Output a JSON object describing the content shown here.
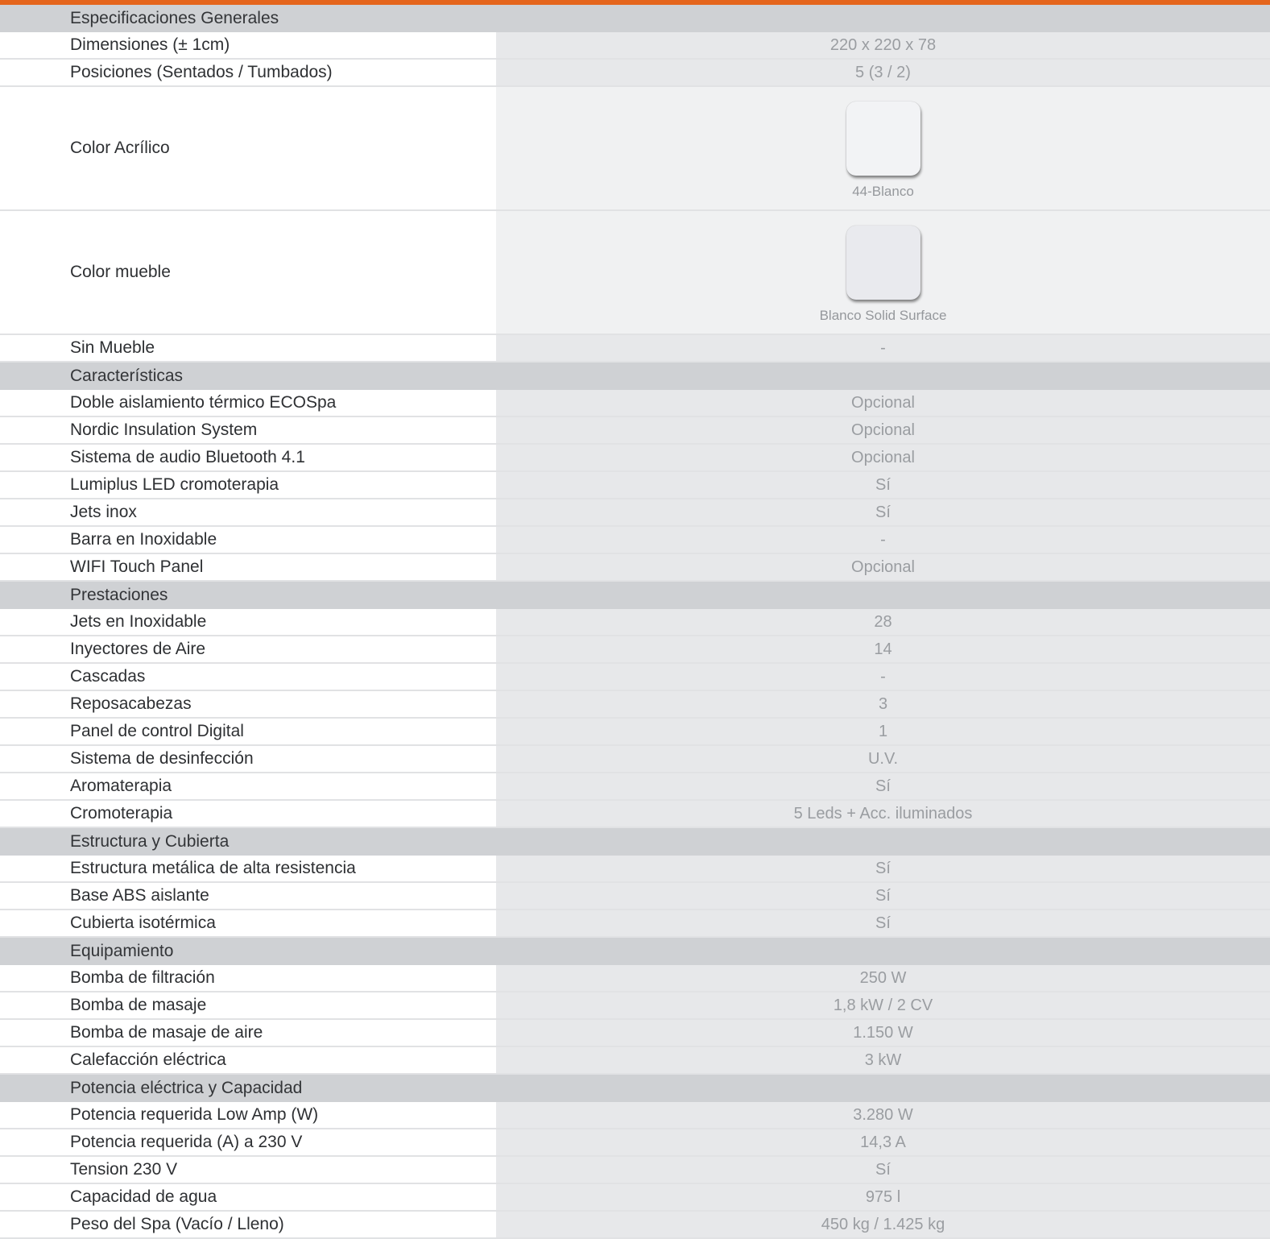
{
  "colors": {
    "accent": "#e5651c",
    "section_bg": "#cfd1d4",
    "value_bg": "#e7e8ea",
    "swatch_acrilico": "#f2f3f5",
    "swatch_mueble": "#e9eaee"
  },
  "sections": [
    {
      "title": "Especificaciones Generales",
      "rows": [
        {
          "label": "Dimensiones (± 1cm)",
          "value": "220 x 220 x 78"
        },
        {
          "label": "Posiciones (Sentados / Tumbados)",
          "value": "5 (3 / 2)"
        },
        {
          "label": "Color Acrílico",
          "swatch_caption": "44-Blanco"
        },
        {
          "label": "Color mueble",
          "swatch_caption": "Blanco Solid Surface"
        },
        {
          "label": "Sin Mueble",
          "value": "-"
        }
      ]
    },
    {
      "title": "Características",
      "rows": [
        {
          "label": "Doble aislamiento térmico ECOSpa",
          "value": "Opcional"
        },
        {
          "label": "Nordic Insulation System",
          "value": "Opcional"
        },
        {
          "label": "Sistema de audio Bluetooth 4.1",
          "value": "Opcional"
        },
        {
          "label": "Lumiplus LED cromoterapia",
          "value": "Sí"
        },
        {
          "label": "Jets inox",
          "value": "Sí"
        },
        {
          "label": "Barra en Inoxidable",
          "value": "-"
        },
        {
          "label": "WIFI Touch Panel",
          "value": "Opcional"
        }
      ]
    },
    {
      "title": "Prestaciones",
      "rows": [
        {
          "label": "Jets en Inoxidable",
          "value": "28"
        },
        {
          "label": "Inyectores de Aire",
          "value": "14"
        },
        {
          "label": "Cascadas",
          "value": "-"
        },
        {
          "label": "Reposacabezas",
          "value": "3"
        },
        {
          "label": "Panel de control Digital",
          "value": "1"
        },
        {
          "label": "Sistema de desinfección",
          "value": "U.V."
        },
        {
          "label": "Aromaterapia",
          "value": "Sí"
        },
        {
          "label": "Cromoterapia",
          "value": "5 Leds + Acc. iluminados"
        }
      ]
    },
    {
      "title": "Estructura y Cubierta",
      "rows": [
        {
          "label": "Estructura metálica de alta resistencia",
          "value": "Sí"
        },
        {
          "label": "Base ABS aislante",
          "value": "Sí"
        },
        {
          "label": "Cubierta isotérmica",
          "value": "Sí"
        }
      ]
    },
    {
      "title": "Equipamiento",
      "rows": [
        {
          "label": "Bomba de filtración",
          "value": "250 W"
        },
        {
          "label": "Bomba de masaje",
          "value": "1,8 kW / 2 CV"
        },
        {
          "label": "Bomba de masaje de aire",
          "value": "1.150 W"
        },
        {
          "label": "Calefacción eléctrica",
          "value": "3 kW"
        }
      ]
    },
    {
      "title": "Potencia eléctrica y Capacidad",
      "rows": [
        {
          "label": "Potencia requerida Low Amp (W)",
          "value": "3.280 W"
        },
        {
          "label": "Potencia requerida (A) a 230 V",
          "value": "14,3 A"
        },
        {
          "label": "Tension 230 V",
          "value": "Sí"
        },
        {
          "label": "Capacidad de agua",
          "value": "975 l"
        },
        {
          "label": "Peso del Spa (Vacío / Lleno)",
          "value": "450 kg / 1.425 kg"
        }
      ]
    }
  ]
}
